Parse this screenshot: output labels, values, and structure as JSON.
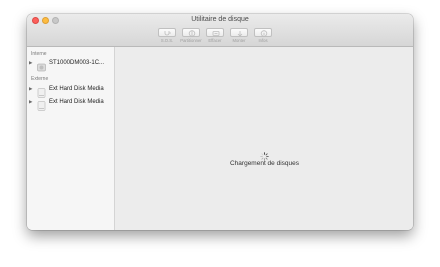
{
  "window": {
    "title": "Utilitaire de disque"
  },
  "toolbar": {
    "buttons": [
      {
        "label": "S.O.S.",
        "icon": "stethoscope-icon"
      },
      {
        "label": "Partitionner",
        "icon": "partition-icon"
      },
      {
        "label": "Effacer",
        "icon": "erase-icon"
      },
      {
        "label": "Monter",
        "icon": "mount-icon"
      },
      {
        "label": "Infos",
        "icon": "info-icon"
      }
    ]
  },
  "sidebar": {
    "internal_header": "Interne",
    "internal_disks": [
      {
        "name": "ST1000DM003-1C...",
        "icon": "internal-disk-icon"
      }
    ],
    "external_header": "Externe",
    "external_disks": [
      {
        "name": "Ext Hard Disk Media",
        "icon": "external-disk-icon"
      },
      {
        "name": "Ext Hard Disk Media",
        "icon": "external-disk-icon"
      }
    ]
  },
  "main": {
    "loading_text": "Chargement de disques"
  },
  "colors": {
    "close": "#fc605c",
    "minimize": "#fdbc40",
    "zoom": "#c8c8c8",
    "sidebar_bg": "#f6f6f6",
    "window_bg": "#ececec"
  }
}
